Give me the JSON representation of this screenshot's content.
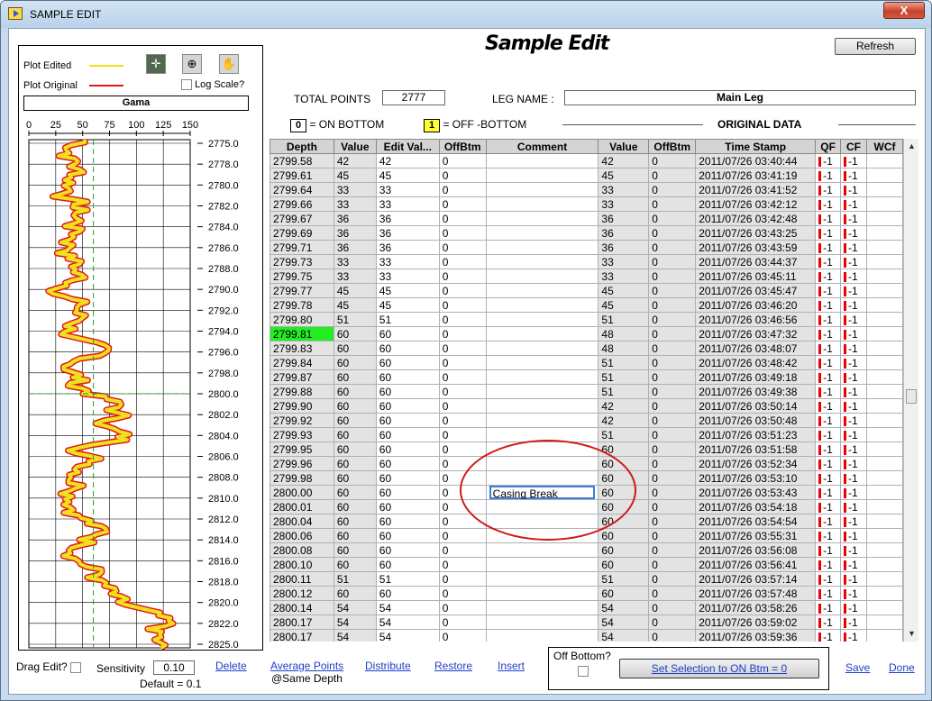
{
  "window": {
    "title": "SAMPLE EDIT",
    "close_label": "X"
  },
  "app": {
    "title": "Sample Edit",
    "refresh_label": "Refresh"
  },
  "plot": {
    "edited_label": "Plot Edited",
    "original_label": "Plot Original",
    "log_scale_label": "Log Scale?",
    "curve_name": "Gama",
    "edited_color": "#f0e020",
    "original_color": "#e01818",
    "x_ticks": [
      "0",
      "25",
      "50",
      "75",
      "100",
      "125",
      "150"
    ],
    "depth_ticks": [
      "2775.0",
      "2778.0",
      "2780.0",
      "2782.0",
      "2784.0",
      "2786.0",
      "2788.0",
      "2790.0",
      "2792.0",
      "2794.0",
      "2796.0",
      "2798.0",
      "2800.0",
      "2802.0",
      "2804.0",
      "2806.0",
      "2808.0",
      "2810.0",
      "2812.0",
      "2814.0",
      "2816.0",
      "2818.0",
      "2820.0",
      "2822.0",
      "2825.0"
    ]
  },
  "info": {
    "total_points_label": "TOTAL POINTS",
    "total_points": "2777",
    "leg_name_label": "LEG NAME :",
    "leg_name": "Main Leg",
    "on_bottom_code": "0",
    "on_bottom_label": "= ON BOTTOM",
    "off_bottom_code": "1",
    "off_bottom_label": "= OFF -BOTTOM",
    "original_data_label": "ORIGINAL DATA",
    "off_bottom_color": "#ffff33"
  },
  "grid": {
    "columns": [
      "Depth",
      "Value",
      "Edit Val...",
      "OffBtm",
      "Comment",
      "Value",
      "OffBtm",
      "Time Stamp",
      "QF",
      "CF",
      "WCf"
    ],
    "rows": [
      [
        "2799.58",
        "42",
        "42",
        "0",
        "",
        "42",
        "0",
        "2011/07/26 03:40:44",
        "-1",
        "-1"
      ],
      [
        "2799.61",
        "45",
        "45",
        "0",
        "",
        "45",
        "0",
        "2011/07/26 03:41:19",
        "-1",
        "-1"
      ],
      [
        "2799.64",
        "33",
        "33",
        "0",
        "",
        "33",
        "0",
        "2011/07/26 03:41:52",
        "-1",
        "-1"
      ],
      [
        "2799.66",
        "33",
        "33",
        "0",
        "",
        "33",
        "0",
        "2011/07/26 03:42:12",
        "-1",
        "-1"
      ],
      [
        "2799.67",
        "36",
        "36",
        "0",
        "",
        "36",
        "0",
        "2011/07/26 03:42:48",
        "-1",
        "-1"
      ],
      [
        "2799.69",
        "36",
        "36",
        "0",
        "",
        "36",
        "0",
        "2011/07/26 03:43:25",
        "-1",
        "-1"
      ],
      [
        "2799.71",
        "36",
        "36",
        "0",
        "",
        "36",
        "0",
        "2011/07/26 03:43:59",
        "-1",
        "-1"
      ],
      [
        "2799.73",
        "33",
        "33",
        "0",
        "",
        "33",
        "0",
        "2011/07/26 03:44:37",
        "-1",
        "-1"
      ],
      [
        "2799.75",
        "33",
        "33",
        "0",
        "",
        "33",
        "0",
        "2011/07/26 03:45:11",
        "-1",
        "-1"
      ],
      [
        "2799.77",
        "45",
        "45",
        "0",
        "",
        "45",
        "0",
        "2011/07/26 03:45:47",
        "-1",
        "-1"
      ],
      [
        "2799.78",
        "45",
        "45",
        "0",
        "",
        "45",
        "0",
        "2011/07/26 03:46:20",
        "-1",
        "-1"
      ],
      [
        "2799.80",
        "51",
        "51",
        "0",
        "",
        "51",
        "0",
        "2011/07/26 03:46:56",
        "-1",
        "-1"
      ],
      [
        "2799.81",
        "60",
        "60",
        "0",
        "",
        "48",
        "0",
        "2011/07/26 03:47:32",
        "-1",
        "-1"
      ],
      [
        "2799.83",
        "60",
        "60",
        "0",
        "",
        "48",
        "0",
        "2011/07/26 03:48:07",
        "-1",
        "-1"
      ],
      [
        "2799.84",
        "60",
        "60",
        "0",
        "",
        "51",
        "0",
        "2011/07/26 03:48:42",
        "-1",
        "-1"
      ],
      [
        "2799.87",
        "60",
        "60",
        "0",
        "",
        "51",
        "0",
        "2011/07/26 03:49:18",
        "-1",
        "-1"
      ],
      [
        "2799.88",
        "60",
        "60",
        "0",
        "",
        "51",
        "0",
        "2011/07/26 03:49:38",
        "-1",
        "-1"
      ],
      [
        "2799.90",
        "60",
        "60",
        "0",
        "",
        "42",
        "0",
        "2011/07/26 03:50:14",
        "-1",
        "-1"
      ],
      [
        "2799.92",
        "60",
        "60",
        "0",
        "",
        "42",
        "0",
        "2011/07/26 03:50:48",
        "-1",
        "-1"
      ],
      [
        "2799.93",
        "60",
        "60",
        "0",
        "",
        "51",
        "0",
        "2011/07/26 03:51:23",
        "-1",
        "-1"
      ],
      [
        "2799.95",
        "60",
        "60",
        "0",
        "",
        "60",
        "0",
        "2011/07/26 03:51:58",
        "-1",
        "-1"
      ],
      [
        "2799.96",
        "60",
        "60",
        "0",
        "",
        "60",
        "0",
        "2011/07/26 03:52:34",
        "-1",
        "-1"
      ],
      [
        "2799.98",
        "60",
        "60",
        "0",
        "",
        "60",
        "0",
        "2011/07/26 03:53:10",
        "-1",
        "-1"
      ],
      [
        "2800.00",
        "60",
        "60",
        "0",
        "Casing Break",
        "60",
        "0",
        "2011/07/26 03:53:43",
        "-1",
        "-1"
      ],
      [
        "2800.01",
        "60",
        "60",
        "0",
        "",
        "60",
        "0",
        "2011/07/26 03:54:18",
        "-1",
        "-1"
      ],
      [
        "2800.04",
        "60",
        "60",
        "0",
        "",
        "60",
        "0",
        "2011/07/26 03:54:54",
        "-1",
        "-1"
      ],
      [
        "2800.06",
        "60",
        "60",
        "0",
        "",
        "60",
        "0",
        "2011/07/26 03:55:31",
        "-1",
        "-1"
      ],
      [
        "2800.08",
        "60",
        "60",
        "0",
        "",
        "60",
        "0",
        "2011/07/26 03:56:08",
        "-1",
        "-1"
      ],
      [
        "2800.10",
        "60",
        "60",
        "0",
        "",
        "60",
        "0",
        "2011/07/26 03:56:41",
        "-1",
        "-1"
      ],
      [
        "2800.11",
        "51",
        "51",
        "0",
        "",
        "51",
        "0",
        "2011/07/26 03:57:14",
        "-1",
        "-1"
      ],
      [
        "2800.12",
        "60",
        "60",
        "0",
        "",
        "60",
        "0",
        "2011/07/26 03:57:48",
        "-1",
        "-1"
      ],
      [
        "2800.14",
        "54",
        "54",
        "0",
        "",
        "54",
        "0",
        "2011/07/26 03:58:26",
        "-1",
        "-1"
      ],
      [
        "2800.17",
        "54",
        "54",
        "0",
        "",
        "54",
        "0",
        "2011/07/26 03:59:02",
        "-1",
        "-1"
      ],
      [
        "2800.17",
        "54",
        "54",
        "0",
        "",
        "54",
        "0",
        "2011/07/26 03:59:36",
        "-1",
        "-1"
      ]
    ]
  },
  "bottom": {
    "drag_edit_label": "Drag Edit?",
    "sensitivity_label": "Sensitivity",
    "sensitivity_value": "0.10",
    "default_label": "Default = 0.1",
    "delete_label": "Delete",
    "average_points_label": "Average Points",
    "same_depth_label": "@Same Depth",
    "distribute_label": "Distribute",
    "restore_label": "Restore",
    "insert_label": "Insert",
    "off_bottom_label": "Off Bottom?",
    "set_selection_label": "Set Selection to ON Btm = 0",
    "save_label": "Save",
    "done_label": "Done"
  }
}
